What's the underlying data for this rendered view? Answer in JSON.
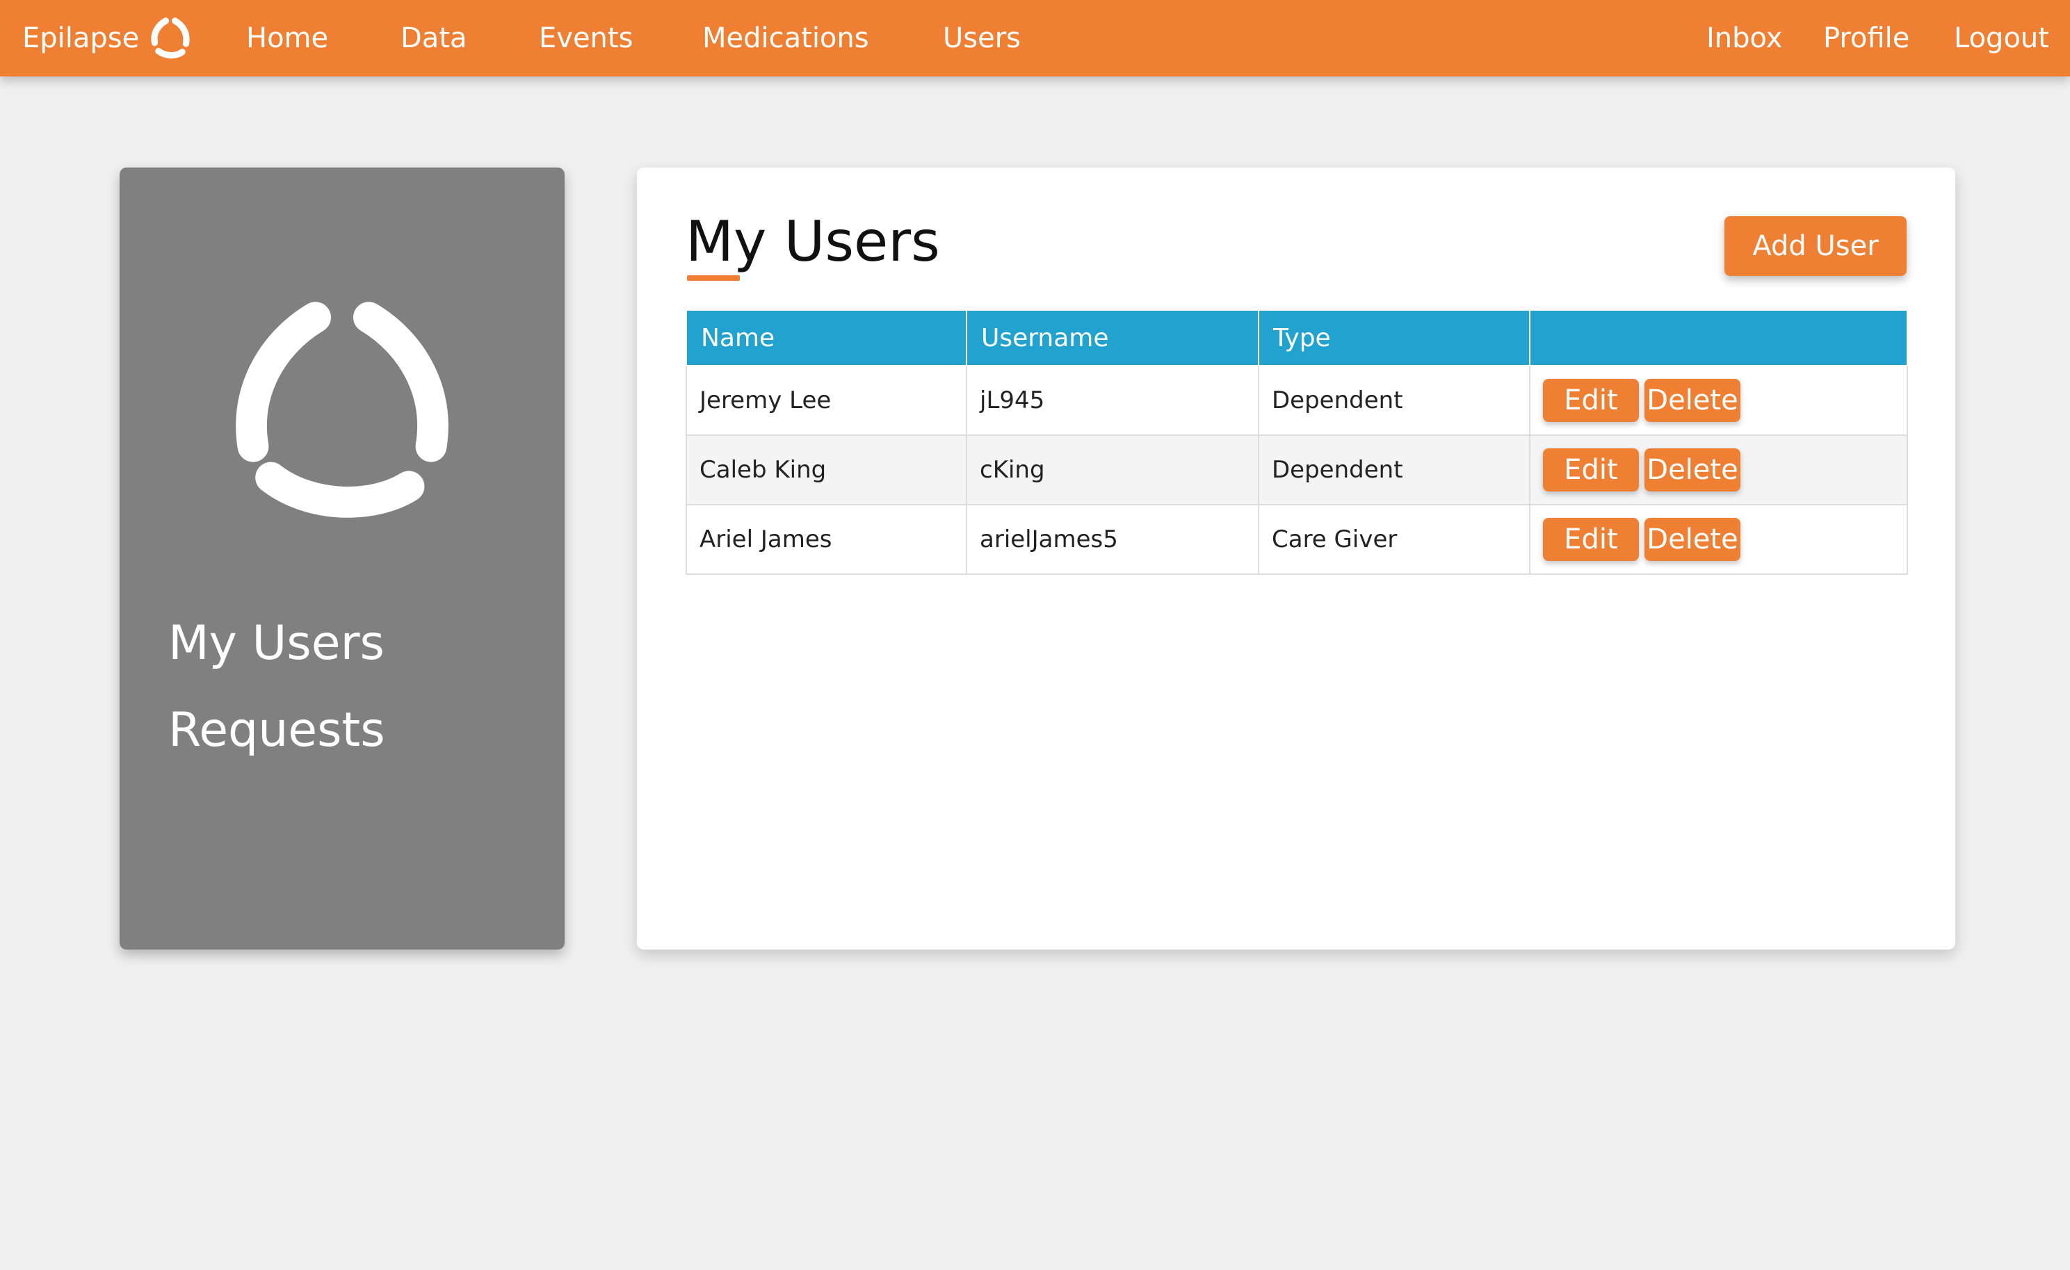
{
  "nav": {
    "brand": "Epilapse",
    "links": [
      "Home",
      "Data",
      "Events",
      "Medications",
      "Users"
    ],
    "right_links": [
      "Inbox",
      "Profile",
      "Logout"
    ]
  },
  "sidebar": {
    "links": [
      "My Users",
      "Requests"
    ]
  },
  "main": {
    "title": "My Users",
    "add_button": "Add User",
    "table": {
      "headers": [
        "Name",
        "Username",
        "Type",
        ""
      ],
      "rows": [
        {
          "name": "Jeremy Lee",
          "username": "jL945",
          "type": "Dependent",
          "edit": "Edit",
          "delete": "Delete"
        },
        {
          "name": "Caleb King",
          "username": "cKing",
          "type": "Dependent",
          "edit": "Edit",
          "delete": "Delete"
        },
        {
          "name": "Ariel James",
          "username": "arielJames5",
          "type": "Care Giver",
          "edit": "Edit",
          "delete": "Delete"
        }
      ]
    }
  },
  "colors": {
    "accent": "#ef7f33",
    "table_header": "#22a3cf",
    "sidebar": "#808080",
    "background": "#f0f0f0"
  },
  "icons": [
    "epilapse-logo-icon"
  ]
}
